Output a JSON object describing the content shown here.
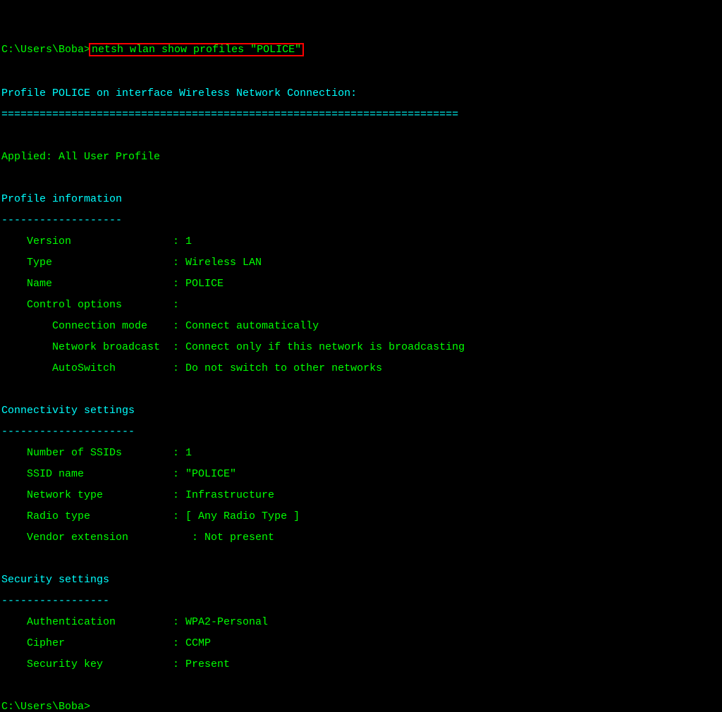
{
  "prompt1": {
    "path": "C:\\Users\\Boba>",
    "command": "netsh wlan show profiles \"POLICE\""
  },
  "header": {
    "line": "Profile POLICE on interface Wireless Network Connection:",
    "eq": "========================================================================"
  },
  "applied": "Applied: All User Profile",
  "profile_info": {
    "title": "Profile information",
    "dash": "-------------------",
    "rows": {
      "version": "    Version                : 1",
      "type": "    Type                   : Wireless LAN",
      "name": "    Name                   : POLICE",
      "control": "    Control options        :",
      "connmode": "        Connection mode    : Connect automatically",
      "broadcast": "        Network broadcast  : Connect only if this network is broadcasting",
      "autosw": "        AutoSwitch         : Do not switch to other networks"
    }
  },
  "connectivity": {
    "title": "Connectivity settings",
    "dash": "---------------------",
    "rows": {
      "numssids": "    Number of SSIDs        : 1",
      "ssidname": "    SSID name              : \"POLICE\"",
      "nettype": "    Network type           : Infrastructure",
      "radiotype": "    Radio type             : [ Any Radio Type ]",
      "vendor": "    Vendor extension          : Not present"
    }
  },
  "security": {
    "title": "Security settings",
    "dash": "-----------------",
    "rows": {
      "auth": "    Authentication         : WPA2-Personal",
      "cipher": "    Cipher                 : CCMP",
      "seckey": "    Security key           : Present"
    }
  },
  "prompt2": {
    "path": "C:\\Users\\Boba>"
  }
}
